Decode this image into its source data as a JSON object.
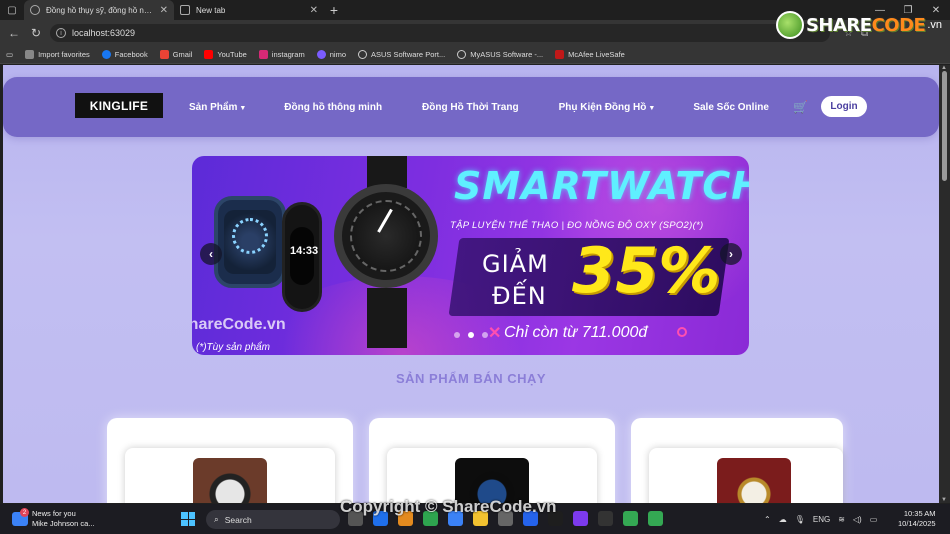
{
  "browser": {
    "tabs": [
      {
        "title": "Đồng hồ thụy sỹ, đồng hồ nam, đ",
        "active": true
      },
      {
        "title": "New tab",
        "active": false
      }
    ],
    "url": "localhost:63029",
    "bookmarks": [
      {
        "label": "Import favorites",
        "color": "#888888"
      },
      {
        "label": "Facebook",
        "color": "#1877f2"
      },
      {
        "label": "Gmail",
        "color": "#ea4335"
      },
      {
        "label": "YouTube",
        "color": "#ff0000"
      },
      {
        "label": "instagram",
        "color": "#d62976"
      },
      {
        "label": "nimo",
        "color": "#7b5cff"
      },
      {
        "label": "ASUS Software Port...",
        "color": "#cccccc"
      },
      {
        "label": "MyASUS Software -...",
        "color": "#cccccc"
      },
      {
        "label": "McAfee LiveSafe",
        "color": "#c01818"
      }
    ]
  },
  "watermark": {
    "logo_prefix": "SHARE",
    "logo_mid": "CODE",
    "logo_suffix": ".vn",
    "banner_mark": "ShareCode.vn",
    "footer_mark": "Copyright © ShareCode.vn"
  },
  "site": {
    "brand": "KINGLIFE",
    "nav": [
      {
        "label": "Sản Phẩm",
        "dropdown": true
      },
      {
        "label": "Đồng hồ thông minh",
        "dropdown": false
      },
      {
        "label": "Đồng Hồ Thời Trang",
        "dropdown": false
      },
      {
        "label": "Phụ Kiện Đồng Hồ",
        "dropdown": true
      },
      {
        "label": "Sale Sốc Online",
        "dropdown": false
      }
    ],
    "login": "Login"
  },
  "banner": {
    "title": "SMARTWATCH",
    "subtitle": "TẬP LUYỆN THỂ THAO | ĐO NỒNG ĐỘ OXY (SPO2)(*)",
    "giam": "GIẢM",
    "den": "ĐẾN",
    "percent": "35%",
    "price": "Chỉ còn từ 711.000đ",
    "note": "(*)Tùy sản phẩm",
    "watch_time": "14:33",
    "slides": 3,
    "active_slide": 2,
    "colors": {
      "title": "#5ff0ff",
      "percent": "#ffe81a"
    }
  },
  "section": {
    "title": "SẢN PHẨM BÁN CHẠY"
  },
  "taskbar": {
    "news_title": "News for you",
    "news_sub": "Mike Johnson ca...",
    "news_badge": "2",
    "search": "Search",
    "lang": "ENG",
    "time": "10:35 AM",
    "date": "10/14/2025"
  }
}
